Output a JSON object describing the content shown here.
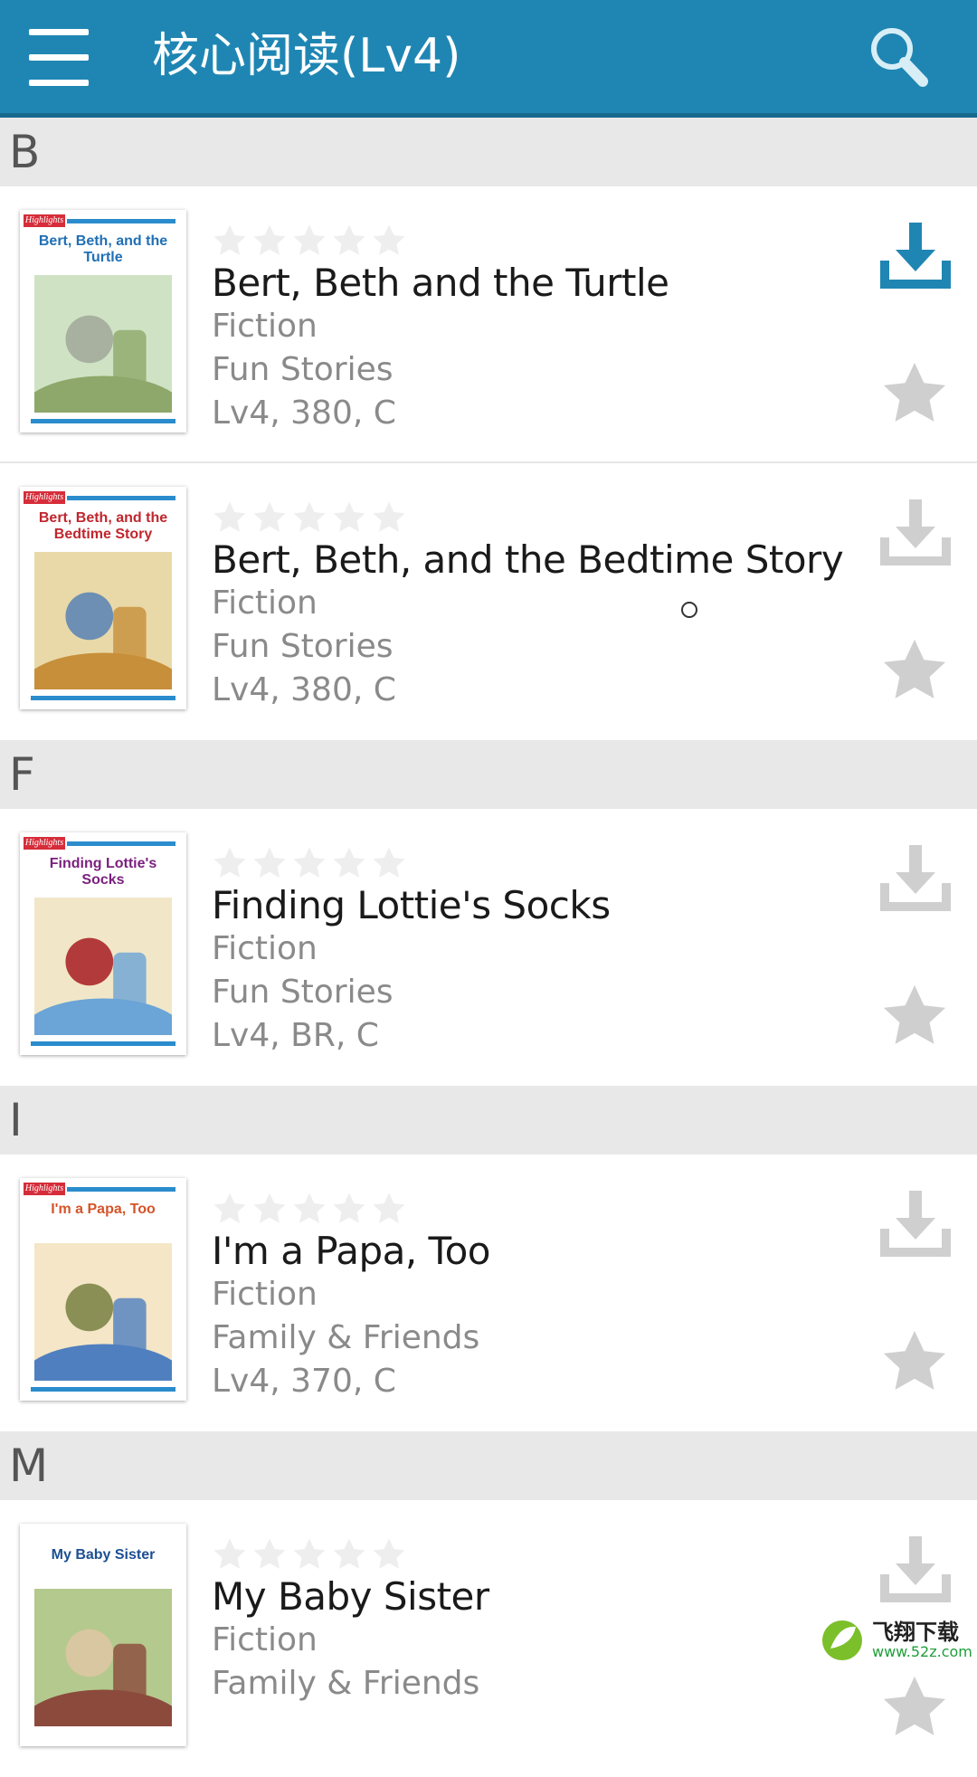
{
  "app_bar": {
    "title": "核心阅读(Lv4)",
    "menu_icon": "hamburger-menu-icon",
    "search_icon": "search-icon",
    "background": "#1f86b3"
  },
  "sections": [
    {
      "letter": "B",
      "books": [
        {
          "title": "Bert, Beth and the Turtle",
          "genre": "Fiction",
          "series": "Fun Stories",
          "level": "Lv4, 380, C",
          "rating": 0,
          "downloaded": true,
          "cover_title": "Bert, Beth, and the Turtle",
          "cover_tag": "Highlights"
        },
        {
          "title": "Bert, Beth, and the Bedtime Story",
          "genre": "Fiction",
          "series": "Fun Stories",
          "level": "Lv4, 380, C",
          "rating": 0,
          "downloaded": false,
          "cover_title": "Bert, Beth, and the Bedtime Story",
          "cover_tag": "Highlights"
        }
      ]
    },
    {
      "letter": "F",
      "books": [
        {
          "title": "Finding Lottie's Socks",
          "genre": "Fiction",
          "series": "Fun Stories",
          "level": "Lv4, BR, C",
          "rating": 0,
          "downloaded": false,
          "cover_title": "Finding Lottie's Socks",
          "cover_tag": "Highlights"
        }
      ]
    },
    {
      "letter": "I",
      "books": [
        {
          "title": "I'm a Papa, Too",
          "genre": "Fiction",
          "series": "Family & Friends",
          "level": "Lv4, 370, C",
          "rating": 0,
          "downloaded": false,
          "cover_title": "I'm a Papa, Too",
          "cover_tag": "Highlights"
        }
      ]
    },
    {
      "letter": "M",
      "books": [
        {
          "title": "My Baby Sister",
          "genre": "Fiction",
          "series": "Family & Friends",
          "level": "",
          "rating": 0,
          "downloaded": false,
          "cover_title": "My Baby Sister",
          "cover_tag": ""
        }
      ]
    }
  ],
  "colors": {
    "download_active": "#1f86b3",
    "download_inactive": "#cfcfcf",
    "favorite": "#cfcfcf",
    "section_bg": "#e8e8e8"
  },
  "watermark": {
    "text": "飞翔下载",
    "url": "www.52z.com"
  }
}
